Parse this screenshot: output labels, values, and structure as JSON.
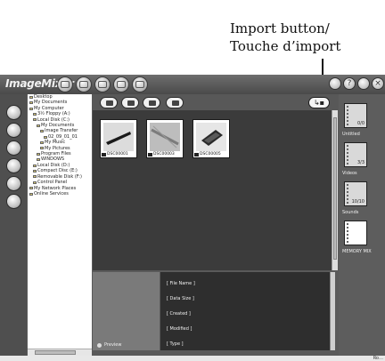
{
  "callout": {
    "line1": "Import button/",
    "line2": "Touche d’import"
  },
  "app": {
    "title": "ImageMixer"
  },
  "tree": {
    "items": [
      "Desktop",
      "My Documents",
      "My Computer",
      "3½ Floppy (A:)",
      "Local Disk (C:)",
      "My Documents",
      "Image Transfer",
      "02_09_01_01",
      "My Music",
      "My Pictures",
      "Program Files",
      "WINDOWS",
      "Local Disk (D:)",
      "Compact Disc (E:)",
      "Removable Disk (F:)",
      "Control Panel",
      "My Network Places",
      "Online Services"
    ]
  },
  "thumbnails": [
    {
      "label": "DSC00001"
    },
    {
      "label": "DSC00003"
    },
    {
      "label": "DSC00005"
    }
  ],
  "preview": {
    "label": "Preview"
  },
  "info": {
    "file_name": "[ File Name ]",
    "data_size": "[ Data Size ]",
    "created": "[ Created ]",
    "modified": "[ Modified ]",
    "type": "[ Type ]"
  },
  "albums": [
    {
      "count": "0/0",
      "name": "Untitled"
    },
    {
      "count": "3/3",
      "name": "Videos"
    },
    {
      "count": "10/10",
      "name": "Sounds"
    },
    {
      "count": "",
      "name": "MEMORY MIX"
    }
  ],
  "status": {
    "text": "Ro…"
  },
  "import_button": {
    "icon": "import-icon"
  }
}
